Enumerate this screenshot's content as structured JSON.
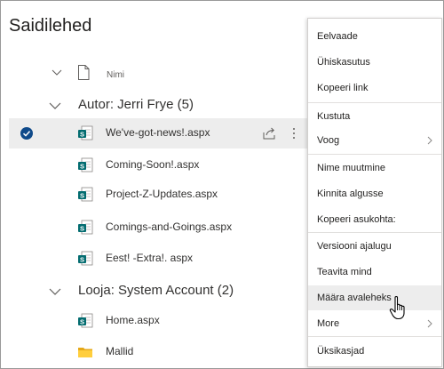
{
  "page": {
    "title": "Saidilehed"
  },
  "list_header": {
    "name_column": "Nimi"
  },
  "groups": [
    {
      "label": "Autor: Jerri Frye (5)",
      "items": [
        {
          "name": "We've-got-news!.aspx",
          "selected": true
        },
        {
          "name": "Coming-Soon!.aspx"
        },
        {
          "name": "Project-Z-Updates.aspx"
        },
        {
          "name": "Comings-and-Goings.aspx"
        },
        {
          "name": "Eest! -Extra!. aspx"
        }
      ]
    },
    {
      "label": "Looja: System Account (2)",
      "items": [
        {
          "name": "Home.aspx"
        },
        {
          "name": "Mallid",
          "type": "folder"
        }
      ]
    }
  ],
  "context_menu": {
    "items": [
      "Eelvaade",
      "Ühiskasutus",
      "Kopeeri link",
      "Kustuta",
      "Voog",
      "Nime muutmine",
      "Kinnita algusse",
      "Kopeeri asukohta:",
      "Versiooni ajalugu",
      "Teavita mind",
      "Määra avaleheks",
      "More",
      "Üksikasjad"
    ],
    "submenu_items": [
      "Voog",
      "More"
    ],
    "hovered_item": "Määra avaleheks"
  },
  "colors": {
    "sharepoint_green": "#036c70",
    "check_blue": "#0f4a8a",
    "folder_yellow": "#ffce3d",
    "selected_row": "#ededed"
  }
}
